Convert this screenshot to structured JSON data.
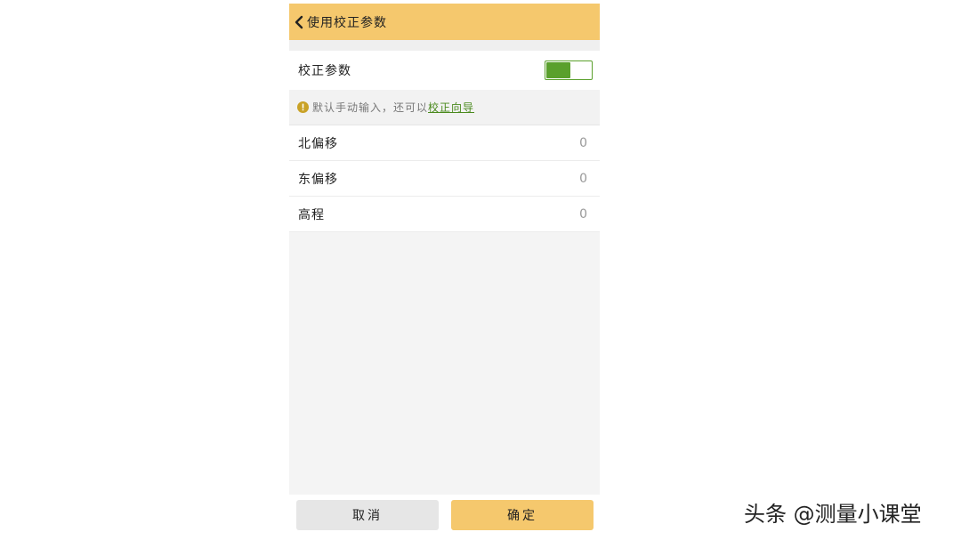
{
  "header": {
    "title": "使用校正参数",
    "background_color": "#f5c86d"
  },
  "switch_row": {
    "label": "校正参数",
    "enabled": true,
    "accent_color": "#5aa02c"
  },
  "info": {
    "icon": "info-icon",
    "text": "默认手动输入，还可以",
    "link": "校正向导"
  },
  "params": [
    {
      "label": "北偏移",
      "value": "0"
    },
    {
      "label": "东偏移",
      "value": "0"
    },
    {
      "label": "高程",
      "value": "0"
    }
  ],
  "footer": {
    "cancel_label": "取消",
    "confirm_label": "确定"
  },
  "watermark": "头条 @测量小课堂"
}
